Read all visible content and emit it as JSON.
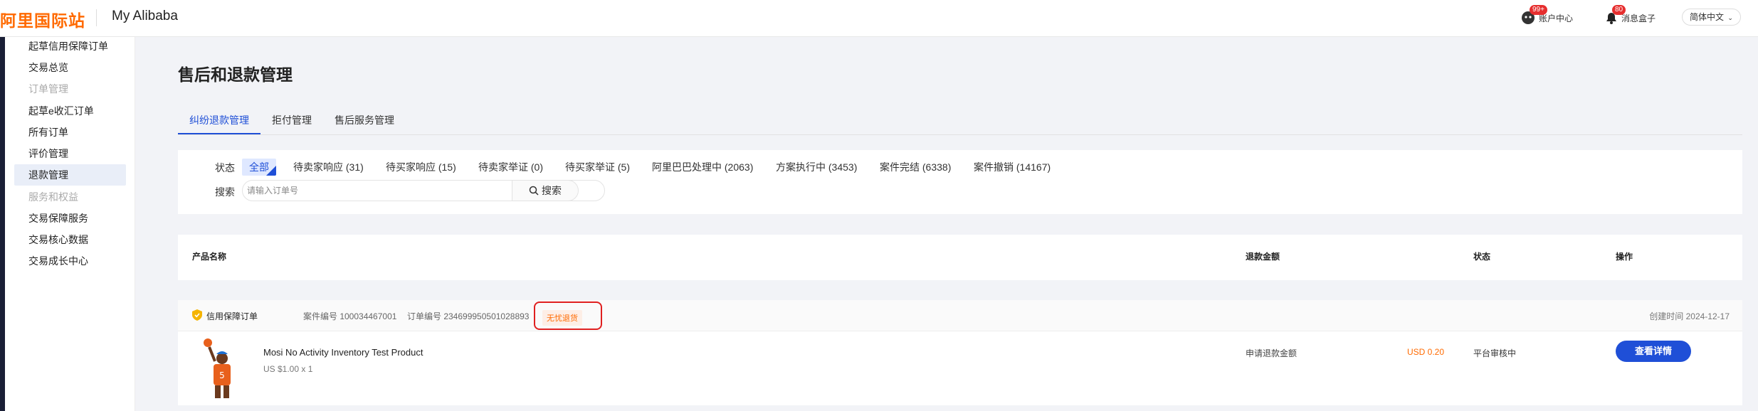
{
  "header": {
    "logo": "阿里国际站",
    "brand": "My Alibaba",
    "account_center": {
      "label": "账户中心",
      "badge": "99+"
    },
    "message_box": {
      "label": "消息盒子",
      "badge": "80"
    },
    "language": "简体中文"
  },
  "sidebar": {
    "items": [
      {
        "label": "起草信用保障订单",
        "type": "link"
      },
      {
        "label": "交易总览",
        "type": "link"
      },
      {
        "label": "订单管理",
        "type": "group"
      },
      {
        "label": "起草e收汇订单",
        "type": "link"
      },
      {
        "label": "所有订单",
        "type": "link"
      },
      {
        "label": "评价管理",
        "type": "link"
      },
      {
        "label": "退款管理",
        "type": "active"
      },
      {
        "label": "服务和权益",
        "type": "group"
      },
      {
        "label": "交易保障服务",
        "type": "link"
      },
      {
        "label": "交易核心数据",
        "type": "link"
      },
      {
        "label": "交易成长中心",
        "type": "link"
      }
    ]
  },
  "page": {
    "title": "售后和退款管理",
    "tabs": [
      "纠纷退款管理",
      "拒付管理",
      "售后服务管理"
    ],
    "active_tab": "纠纷退款管理"
  },
  "filter": {
    "status_label": "状态",
    "search_label": "搜索",
    "statuses": [
      "全部",
      "待卖家响应 (31)",
      "待买家响应 (15)",
      "待卖家举证 (0)",
      "待买家举证 (5)",
      "阿里巴巴处理中 (2063)",
      "方案执行中 (3453)",
      "案件完结 (6338)",
      "案件撤销 (14167)"
    ],
    "selected": "全部",
    "search_placeholder": "请输入订单号",
    "search_button": "搜索"
  },
  "table": {
    "headers": [
      "产品名称",
      "退款金额",
      "状态",
      "操作"
    ]
  },
  "order": {
    "type": "信用保障订单",
    "case_no": "案件编号 100034467001",
    "order_no": "订单编号 234699950501028893",
    "tag": "无忧退货",
    "created": "创建时间 2024-12-17",
    "product_name": "Mosi No Activity Inventory Test Product",
    "price_qty": "US $1.00 x 1",
    "refund_label": "申请退款金额",
    "amount": "USD 0.20",
    "status": "平台审核中",
    "action": "查看详情"
  },
  "colors": {
    "brand_orange": "#ff6a00",
    "primary_blue": "#1f4fd7",
    "highlight_red": "#e02020"
  }
}
